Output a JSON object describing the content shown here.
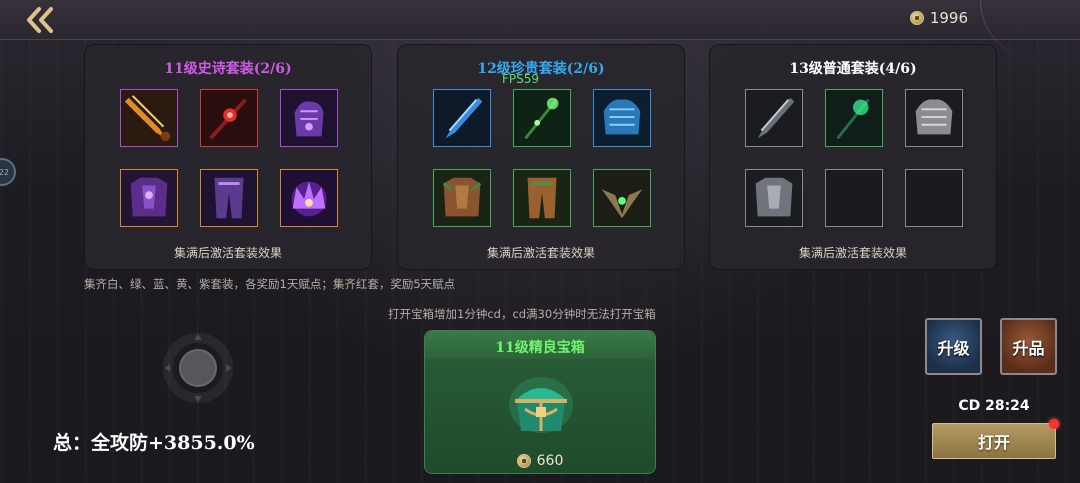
{
  "header": {
    "currency_amount": "1996",
    "back_icon": "chevron-left-icon"
  },
  "side_badge": "22",
  "sets": [
    {
      "title": "11级史诗套装(2/6)",
      "title_color": "#d05ae8",
      "footer": "集满后激活套装效果",
      "slots": [
        {
          "name": "flame-dagger",
          "filled": true,
          "border": "#a54ed3"
        },
        {
          "name": "crimson-staff",
          "filled": true,
          "border": "#d23b3b"
        },
        {
          "name": "purple-gauntlet",
          "filled": true,
          "border": "#a54ed3"
        },
        {
          "name": "purple-chestplate",
          "filled": true,
          "border": "#d8862e"
        },
        {
          "name": "purple-leggings",
          "filled": true,
          "border": "#d8862e"
        },
        {
          "name": "arcane-crown",
          "filled": true,
          "border": "#d8862e"
        }
      ]
    },
    {
      "title": "12级珍贵套装(2/6)",
      "title_color": "#34a8f0",
      "footer": "集满后激活套装效果",
      "slots": [
        {
          "name": "azure-dagger",
          "filled": true,
          "border": "#3a8fd8"
        },
        {
          "name": "jade-staff",
          "filled": true,
          "border": "#4aa85a"
        },
        {
          "name": "azure-gauntlet",
          "filled": true,
          "border": "#3a8fd8"
        },
        {
          "name": "bronze-chestplate",
          "filled": true,
          "border": "#4aa85a"
        },
        {
          "name": "bronze-leggings",
          "filled": true,
          "border": "#4aa85a"
        },
        {
          "name": "horned-helm",
          "filled": true,
          "border": "#4aa85a"
        }
      ]
    },
    {
      "title": "13级普通套装(4/6)",
      "title_color": "#ffffff",
      "footer": "集满后激活套装效果",
      "slots": [
        {
          "name": "steel-dagger",
          "filled": true,
          "border": "#8a8a8a"
        },
        {
          "name": "emerald-staff",
          "filled": true,
          "border": "#4aa85a"
        },
        {
          "name": "steel-gauntlet",
          "filled": true,
          "border": "#8a8a8a"
        },
        {
          "name": "steel-chestplate",
          "filled": true,
          "border": "#8a8a8a"
        },
        {
          "name": "empty-slot",
          "filled": false,
          "border": "#8a8a8a"
        },
        {
          "name": "empty-slot",
          "filled": false,
          "border": "#8a8a8a"
        }
      ]
    }
  ],
  "collection_hint": "集齐白、绿、蓝、黄、紫套装，各奖励1天赋点；集齐红套，奖励5天赋点",
  "fps_label": "FPS59",
  "cd_hint": "打开宝箱增加1分钟cd，cd满30分钟时无法打开宝箱",
  "chest": {
    "title": "11级精良宝箱",
    "price": "660",
    "icon": "treasure-chest-icon"
  },
  "total_stat": "总：全攻防+3855.0%",
  "buttons": {
    "upgrade": "升级",
    "upgrade_quality": "升品",
    "open": "打开"
  },
  "cd_timer": "CD 28:24"
}
